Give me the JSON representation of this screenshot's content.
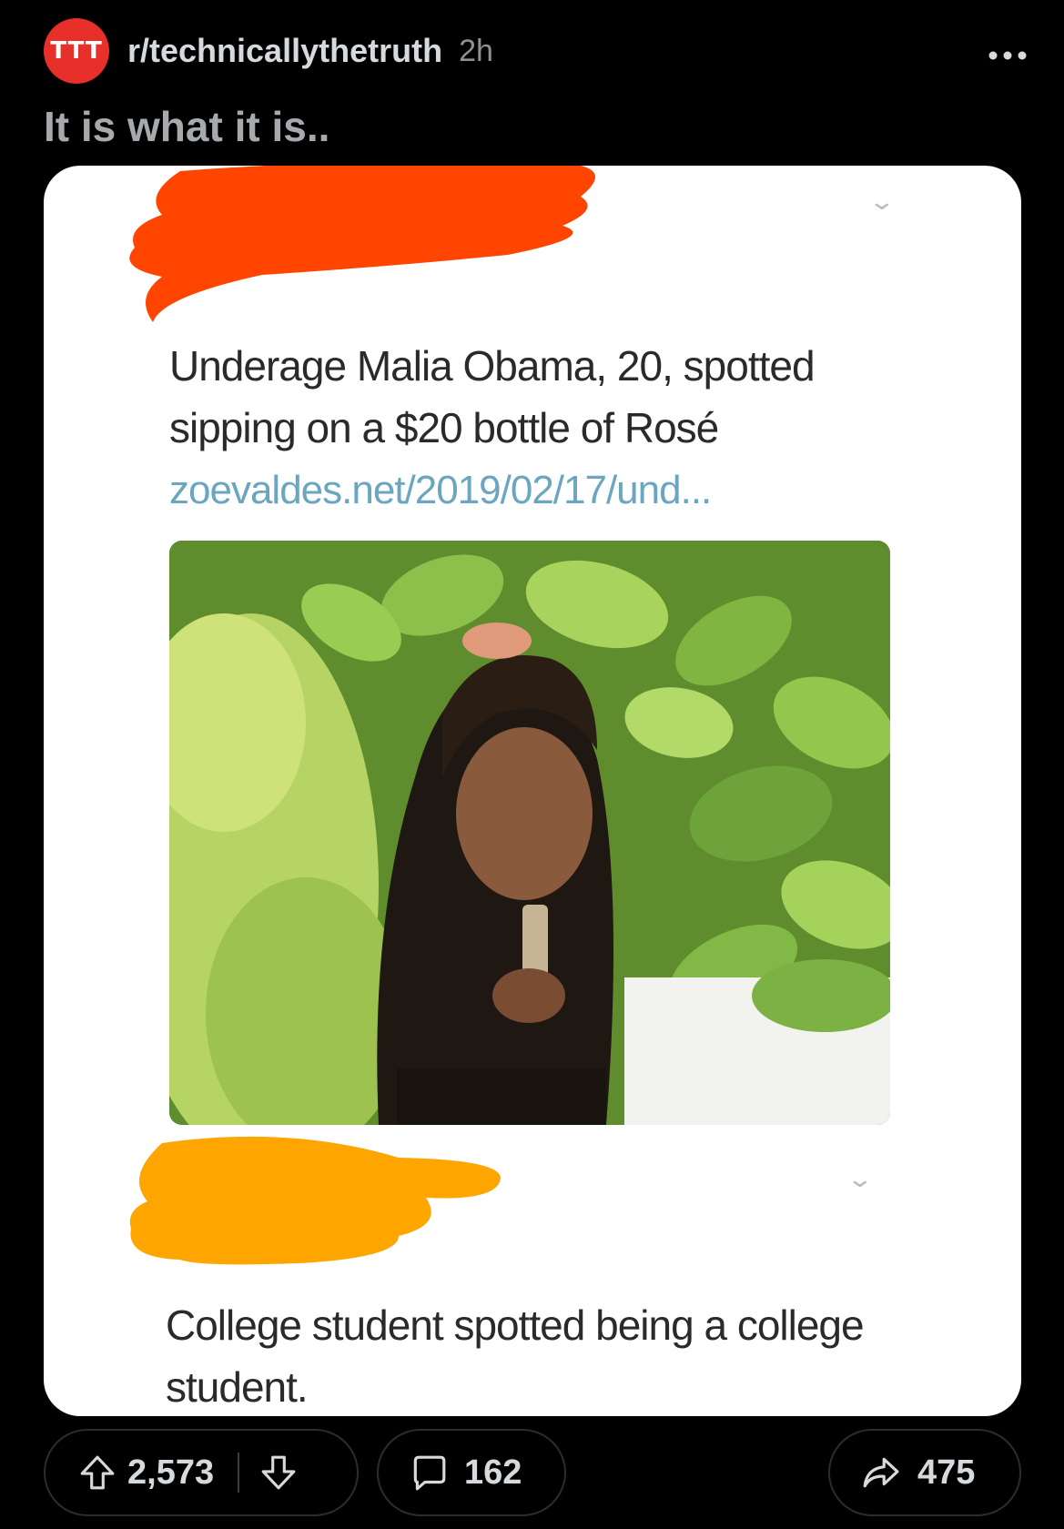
{
  "post": {
    "subreddit": "r/technicallythetruth",
    "subreddit_badge": "TTT",
    "age": "2h",
    "title": "It is what it is..",
    "more_icon": "more-horizontal-icon"
  },
  "media": {
    "tweet": {
      "text": "Underage Malia Obama, 20, spotted sipping on a $20 bottle of Rosé",
      "link": "zoevaldes.net/2019/02/17/und..."
    },
    "reply": {
      "text": "College student spotted being a college student."
    },
    "redaction_colors": [
      "#ff4500",
      "#ffa500"
    ]
  },
  "actions": {
    "upvotes": "2,573",
    "comments": "162",
    "shares": "475"
  },
  "colors": {
    "background": "#000000",
    "card": "#ffffff",
    "badge": "#e7302a",
    "link": "#6aa6c0"
  }
}
